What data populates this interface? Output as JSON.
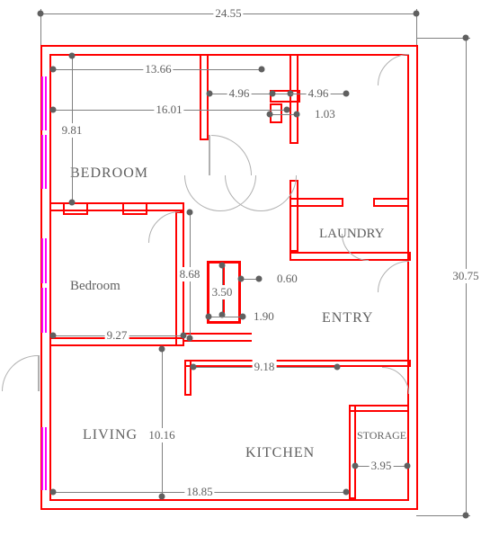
{
  "chart_data": {
    "type": "floorplan",
    "title": "",
    "units": "meters",
    "overall": {
      "width": 24.55,
      "height": 30.75
    },
    "rooms": [
      {
        "name": "BEDROOM",
        "label": "BEDROOM"
      },
      {
        "name": "Bedroom",
        "label": "Bedroom"
      },
      {
        "name": "LAUNDRY",
        "label": "LAUNDRY"
      },
      {
        "name": "ENTRY",
        "label": "ENTRY"
      },
      {
        "name": "LIVING",
        "label": "LIVING"
      },
      {
        "name": "KITCHEN",
        "label": "KITCHEN"
      },
      {
        "name": "STORAGE",
        "label": "STORAGE"
      }
    ],
    "dimensions": {
      "d_24_55": "24.55",
      "d_30_75": "30.75",
      "d_13_66": "13.66",
      "d_4_96a": "4.96",
      "d_4_96b": "4.96",
      "d_16_01": "16.01",
      "d_1_03": "1.03",
      "d_9_81": "9.81",
      "d_8_68": "8.68",
      "d_3_50": "3.50",
      "d_0_60": "0.60",
      "d_1_90": "1.90",
      "d_9_27": "9.27",
      "d_9_18": "9.18",
      "d_10_16": "10.16",
      "d_18_85": "18.85",
      "d_3_95": "3.95"
    }
  },
  "rooms": {
    "bedroom_upper": "BEDROOM",
    "bedroom_lower": "Bedroom",
    "laundry": "LAUNDRY",
    "entry": "ENTRY",
    "living": "LIVING",
    "kitchen": "KITCHEN",
    "storage": "STORAGE"
  },
  "dims": {
    "d_24_55": "24.55",
    "d_30_75": "30.75",
    "d_13_66": "13.66",
    "d_4_96a": "4.96",
    "d_4_96b": "4.96",
    "d_16_01": "16.01",
    "d_1_03": "1.03",
    "d_9_81": "9.81",
    "d_8_68": "8.68",
    "d_3_50": "3.50",
    "d_0_60": "0.60",
    "d_1_90": "1.90",
    "d_9_27": "9.27",
    "d_9_18": "9.18",
    "d_10_16": "10.16",
    "d_18_85": "18.85",
    "d_3_95": "3.95"
  }
}
